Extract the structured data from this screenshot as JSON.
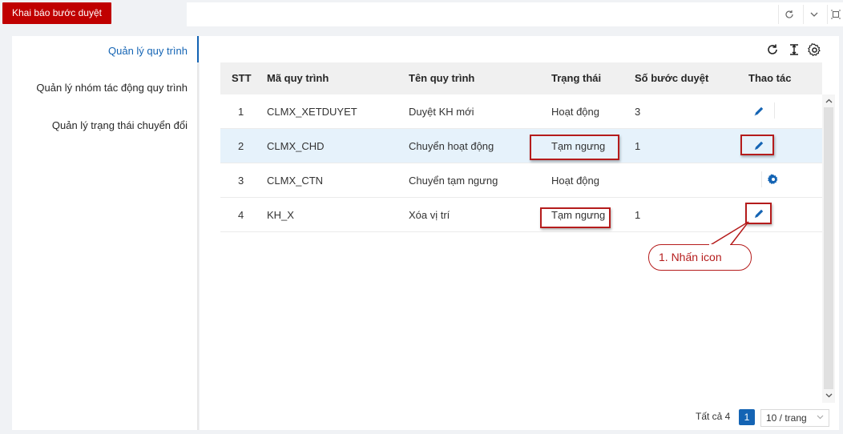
{
  "tab": {
    "label": "Khai báo bước duyệt"
  },
  "sidebar": {
    "items": [
      {
        "label": "Quản lý quy trình"
      },
      {
        "label": "Quản lý nhóm tác động quy trình"
      },
      {
        "label": "Quản lý trạng thái chuyển đổi"
      }
    ]
  },
  "table": {
    "columns": [
      "STT",
      "Mã quy trình",
      "Tên quy trình",
      "Trạng thái",
      "Số bước duyệt",
      "Thao tác"
    ],
    "rows": [
      {
        "stt": "1",
        "code": "CLMX_XETDUYET",
        "name": "Duyệt KH mới",
        "status": "Hoạt động",
        "steps": "3",
        "action": "edit-icon"
      },
      {
        "stt": "2",
        "code": "CLMX_CHD",
        "name": "Chuyển hoạt động",
        "status": "Tạm ngưng",
        "steps": "1",
        "action": "edit-icon"
      },
      {
        "stt": "3",
        "code": "CLMX_CTN",
        "name": "Chuyển tạm ngưng",
        "status": "Hoạt động",
        "steps": "",
        "action": "settings-icon"
      },
      {
        "stt": "4",
        "code": "KH_X",
        "name": "Xóa vị trí",
        "status": "Tạm ngưng",
        "steps": "1",
        "action": "edit-icon"
      }
    ]
  },
  "callout": {
    "text": "1. Nhấn icon"
  },
  "pagination": {
    "total": "Tất cả 4",
    "current_page": "1",
    "page_size": "10 / trang"
  },
  "colors": {
    "accent": "#1464b4",
    "tab": "#c00000",
    "annotation": "#b51c1c",
    "row_highlight": "#e6f2fb"
  }
}
